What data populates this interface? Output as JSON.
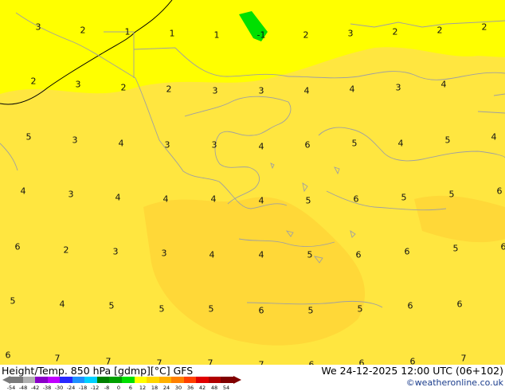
{
  "title_left": "Height/Temp. 850 hPa [gdmp][°C] GFS",
  "title_right": "We 24-12-2025 12:00 UTC (06+102)",
  "credit": "©weatheronline.co.uk",
  "colorbar": {
    "ticks": [
      "-54",
      "-48",
      "-42",
      "-38",
      "-30",
      "-24",
      "-18",
      "-12",
      "-8",
      "0",
      "6",
      "12",
      "18",
      "24",
      "30",
      "36",
      "42",
      "48",
      "54"
    ],
    "colors": [
      "#7a7a7a",
      "#b0b0b0",
      "#8a00c8",
      "#c000ff",
      "#2828ff",
      "#1e90ff",
      "#00d0ff",
      "#008000",
      "#00a000",
      "#00e000",
      "#ffff00",
      "#ffd700",
      "#ffb000",
      "#ff8000",
      "#ff4000",
      "#e00000",
      "#b00000",
      "#800000"
    ]
  },
  "colors": {
    "background_yellow": "#ffff00",
    "warm_yellow": "#ffe640",
    "warmer_yellow": "#ffd838",
    "green_patch": "#00e000",
    "coastline": "#a0a0a0",
    "contour": "#000000"
  },
  "temperature_labels": [
    "3",
    "2",
    "1",
    "1",
    "1",
    "-1",
    "2",
    "3",
    "2",
    "2",
    "2",
    "2",
    "3",
    "2",
    "2",
    "3",
    "3",
    "4",
    "4",
    "3",
    "4",
    "5",
    "3",
    "4",
    "3",
    "3",
    "4",
    "6",
    "5",
    "4",
    "5",
    "4",
    "4",
    "3",
    "4",
    "4",
    "4",
    "4",
    "5",
    "6",
    "5",
    "5",
    "6",
    "6",
    "2",
    "3",
    "3",
    "4",
    "4",
    "5",
    "6",
    "6",
    "5",
    "6",
    "5",
    "4",
    "5",
    "5",
    "5",
    "6",
    "5",
    "5",
    "6",
    "6",
    "6",
    "7",
    "7",
    "7",
    "7",
    "7",
    "6",
    "6",
    "6",
    "7"
  ]
}
